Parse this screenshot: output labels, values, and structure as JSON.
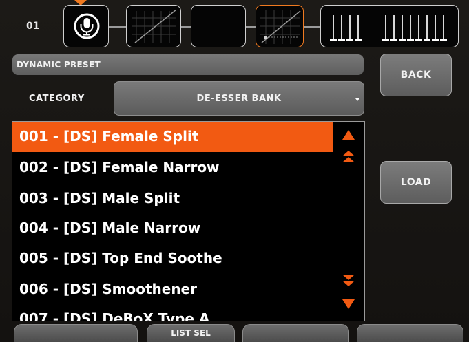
{
  "header": {
    "channel_number": "01",
    "modules": [
      {
        "name": "mic-input",
        "icon": "microphone-icon"
      },
      {
        "name": "gate",
        "icon": "gate-curve-icon"
      },
      {
        "name": "eq",
        "icon": "eq-icon"
      },
      {
        "name": "dynamics",
        "icon": "dynamics-curve-icon",
        "selected": true
      },
      {
        "name": "meters",
        "icon": "meter-bars-icon"
      }
    ],
    "accent_color": "#f07a20"
  },
  "preset_panel": {
    "title": "DYNAMIC PRESET",
    "category_label": "CATEGORY",
    "category_value": "DE-ESSER BANK"
  },
  "preset_list": {
    "selected_index": 0,
    "items": [
      "001 - [DS] Female Split",
      "002 - [DS] Female Narrow",
      "003 - [DS] Male Split",
      "004 - [DS] Male Narrow",
      "005 - [DS] Top End Soothe",
      "006 - [DS] Smoothener",
      "007 - [DS] DeBoX Type A"
    ],
    "highlight_color": "#f25a12"
  },
  "buttons": {
    "back": "BACK",
    "load": "LOAD"
  },
  "soft_keys": [
    "",
    "LIST SEL",
    "",
    ""
  ]
}
